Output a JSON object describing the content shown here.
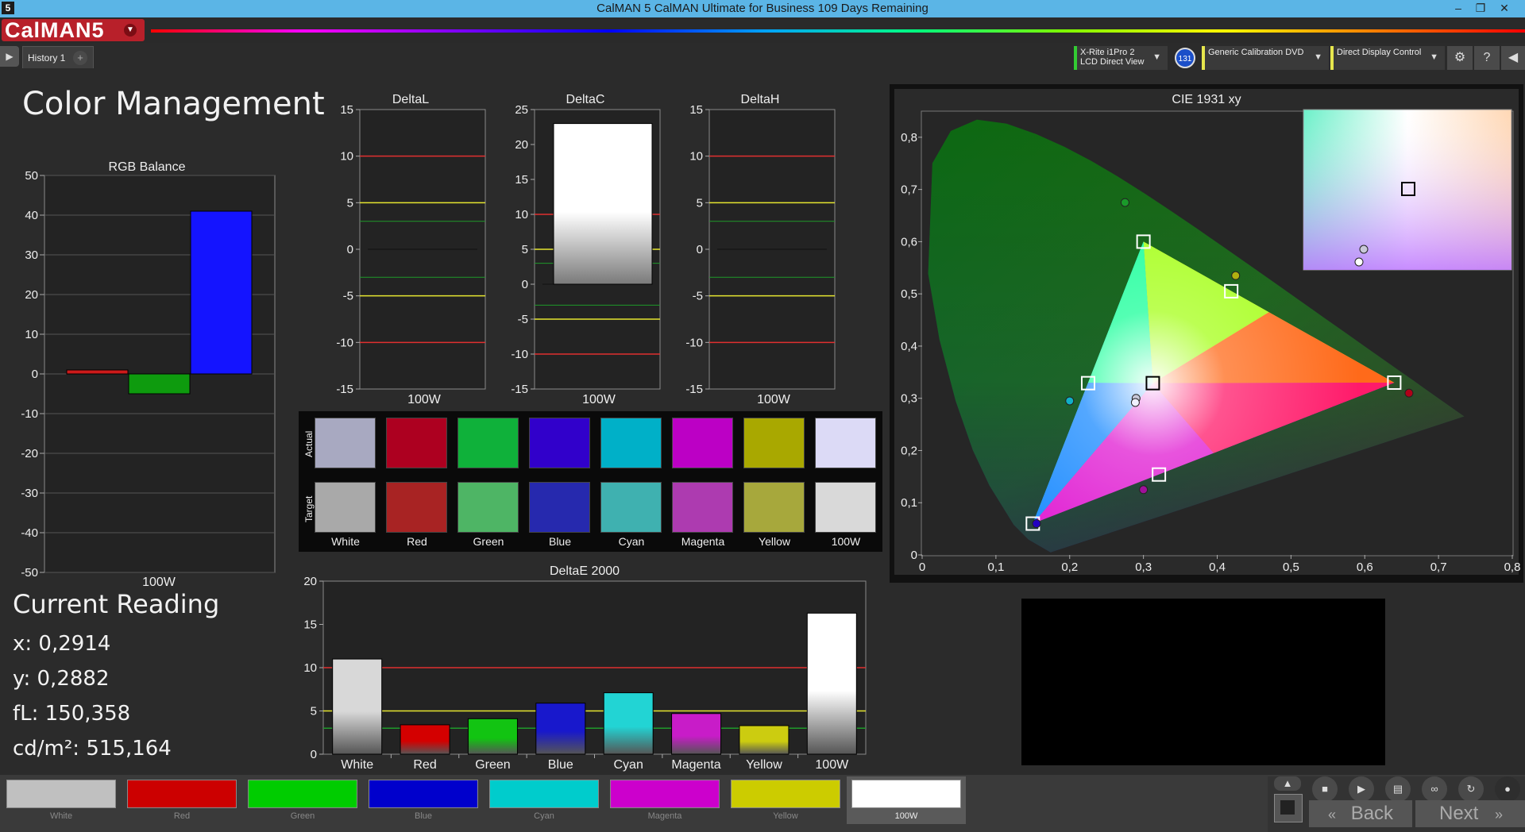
{
  "window": {
    "title": "CalMAN 5 CalMAN Ultimate for Business 109 Days Remaining",
    "app_icon_text": "5"
  },
  "logo": {
    "text": "CalMAN5"
  },
  "tabs": [
    {
      "label": "History 1"
    }
  ],
  "devices": {
    "meter_line1": "X-Rite i1Pro 2",
    "meter_line2": "LCD Direct View",
    "meter_badge": "131",
    "source": "Generic Calibration DVD",
    "display": "Direct Display Control",
    "meter_color": "#33cc33",
    "source_color": "#e6e64d",
    "display_color": "#e6e64d"
  },
  "page": {
    "title": "Color Management"
  },
  "rgb_balance": {
    "title": "RGB Balance",
    "category": "100W",
    "yticks": [
      "50",
      "40",
      "30",
      "20",
      "10",
      "0",
      "-10",
      "-20",
      "-30",
      "-40",
      "-50"
    ]
  },
  "delta_charts": [
    {
      "title": "DeltaL",
      "category": "100W",
      "yticks": [
        "15",
        "10",
        "5",
        "0",
        "-5",
        "-10",
        "-15"
      ]
    },
    {
      "title": "DeltaC",
      "category": "100W",
      "yticks": [
        "25",
        "20",
        "15",
        "10",
        "5",
        "0",
        "-5",
        "-10",
        "-15"
      ]
    },
    {
      "title": "DeltaH",
      "category": "100W",
      "yticks": [
        "15",
        "10",
        "5",
        "0",
        "-5",
        "-10",
        "-15"
      ]
    }
  ],
  "swatches": {
    "row_actual": "Actual",
    "row_target": "Target",
    "items": [
      {
        "label": "White",
        "actual": "#a8a9c1",
        "target": "#a9a9a9"
      },
      {
        "label": "Red",
        "actual": "#ad0020",
        "target": "#a82323"
      },
      {
        "label": "Green",
        "actual": "#0fb13a",
        "target": "#4eb565"
      },
      {
        "label": "Blue",
        "actual": "#3100cb",
        "target": "#2629ae"
      },
      {
        "label": "Cyan",
        "actual": "#00b0c8",
        "target": "#3fb1b0"
      },
      {
        "label": "Magenta",
        "actual": "#bc00c5",
        "target": "#ad3bb0"
      },
      {
        "label": "Yellow",
        "actual": "#a9a800",
        "target": "#a7a83c"
      },
      {
        "label": "100W",
        "actual": "#dcdaf6",
        "target": "#d9d9d9"
      }
    ]
  },
  "cie": {
    "title": "CIE 1931 xy",
    "xticks": [
      "0",
      "0,1",
      "0,2",
      "0,3",
      "0,4",
      "0,5",
      "0,6",
      "0,7",
      "0,8"
    ],
    "yticks": [
      "0",
      "0,1",
      "0,2",
      "0,3",
      "0,4",
      "0,5",
      "0,6",
      "0,7",
      "0,8"
    ]
  },
  "readout": {
    "title": "Current Reading",
    "x": "x: 0,2914",
    "y": "y: 0,2882",
    "fl": "fL: 150,358",
    "cdm2": "cd/m²: 515,164"
  },
  "deltae": {
    "title": "DeltaE 2000",
    "yticks": [
      "20",
      "15",
      "10",
      "5",
      "0"
    ]
  },
  "bottom_swatches": [
    {
      "label": "White",
      "color": "#c0c0c0"
    },
    {
      "label": "Red",
      "color": "#cc0000"
    },
    {
      "label": "Green",
      "color": "#00cc00"
    },
    {
      "label": "Blue",
      "color": "#0000cc"
    },
    {
      "label": "Cyan",
      "color": "#00cccc"
    },
    {
      "label": "Magenta",
      "color": "#cc00cc"
    },
    {
      "label": "Yellow",
      "color": "#cccc00"
    },
    {
      "label": "100W",
      "color": "#ffffff"
    }
  ],
  "nav": {
    "back": "Back",
    "next": "Next"
  },
  "chart_data": [
    {
      "type": "bar",
      "title": "RGB Balance",
      "categories": [
        "100W"
      ],
      "series": [
        {
          "name": "R",
          "values": [
            1
          ],
          "color": "#cc1a1a"
        },
        {
          "name": "G",
          "values": [
            -5
          ],
          "color": "#0e9b0e"
        },
        {
          "name": "B",
          "values": [
            41
          ],
          "color": "#1414ff"
        }
      ],
      "ylim": [
        -50,
        50
      ]
    },
    {
      "type": "bar",
      "title": "DeltaL",
      "categories": [
        "100W"
      ],
      "values": [
        0
      ],
      "ylim": [
        -15,
        15
      ],
      "thresholds": [
        10,
        5,
        3
      ]
    },
    {
      "type": "bar",
      "title": "DeltaC",
      "categories": [
        "100W"
      ],
      "values": [
        23
      ],
      "ylim": [
        -15,
        25
      ],
      "thresholds": [
        10,
        5,
        3
      ]
    },
    {
      "type": "bar",
      "title": "DeltaH",
      "categories": [
        "100W"
      ],
      "values": [
        0
      ],
      "ylim": [
        -15,
        15
      ],
      "thresholds": [
        10,
        5,
        3
      ]
    },
    {
      "type": "scatter",
      "title": "CIE 1931 xy",
      "xlim": [
        0,
        0.8
      ],
      "ylim": [
        0,
        0.85
      ],
      "targets": [
        {
          "name": "Red",
          "x": 0.64,
          "y": 0.33
        },
        {
          "name": "Green",
          "x": 0.3,
          "y": 0.6
        },
        {
          "name": "Blue",
          "x": 0.15,
          "y": 0.06
        },
        {
          "name": "Cyan",
          "x": 0.225,
          "y": 0.329
        },
        {
          "name": "Magenta",
          "x": 0.321,
          "y": 0.154
        },
        {
          "name": "Yellow",
          "x": 0.419,
          "y": 0.505
        },
        {
          "name": "White",
          "x": 0.3127,
          "y": 0.329
        }
      ],
      "measured": [
        {
          "name": "Red",
          "x": 0.66,
          "y": 0.31,
          "color": "#b00018"
        },
        {
          "name": "Green",
          "x": 0.275,
          "y": 0.675,
          "color": "#1a9a2a"
        },
        {
          "name": "Blue",
          "x": 0.155,
          "y": 0.06,
          "color": "#2200c0"
        },
        {
          "name": "Cyan",
          "x": 0.2,
          "y": 0.295,
          "color": "#10b0c8"
        },
        {
          "name": "Magenta",
          "x": 0.3,
          "y": 0.125,
          "color": "#a0109a"
        },
        {
          "name": "Yellow",
          "x": 0.425,
          "y": 0.535,
          "color": "#b0b010"
        },
        {
          "name": "White",
          "x": 0.29,
          "y": 0.3,
          "color": "#c8c8d8"
        },
        {
          "name": "100W",
          "x": 0.289,
          "y": 0.292,
          "color": "#f0f0ff"
        }
      ]
    },
    {
      "type": "bar",
      "title": "DeltaE 2000",
      "categories": [
        "White",
        "Red",
        "Green",
        "Blue",
        "Cyan",
        "Magenta",
        "Yellow",
        "100W"
      ],
      "values": [
        11,
        3.4,
        4.1,
        5.9,
        7.1,
        4.7,
        3.3,
        16.3
      ],
      "colors": [
        "#d8d8d8",
        "#d40000",
        "#12c412",
        "#1818cc",
        "#22d4d4",
        "#c81cc8",
        "#cccc10",
        "#ffffff"
      ],
      "ylim": [
        0,
        20
      ],
      "thresholds": [
        10,
        5,
        3
      ]
    }
  ]
}
